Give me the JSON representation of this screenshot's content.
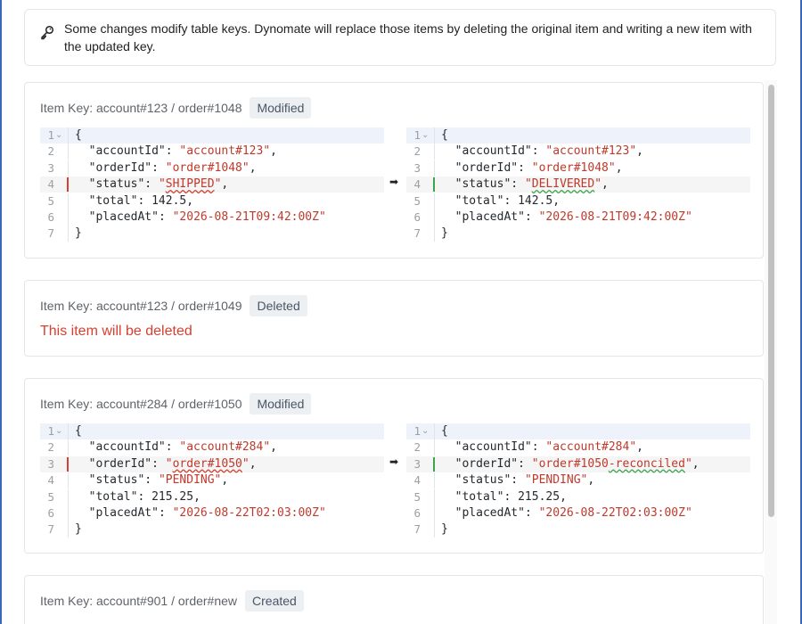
{
  "notice": {
    "icon": "key-icon",
    "text": "Some changes modify table keys. Dynomate will replace those items by deleting the original item and writing a new item with the updated key."
  },
  "colors": {
    "deleted": "#d64030",
    "added": "#3fa34d",
    "string": "#c0392b"
  },
  "items": [
    {
      "key_label": "Item Key: account#123 / order#1048",
      "status": "Modified",
      "changed_line": 4,
      "left": [
        {
          "n": "1",
          "text": "{"
        },
        {
          "n": "2",
          "key": "\"accountId\"",
          "val": "\"account#123\"",
          "tail": ","
        },
        {
          "n": "3",
          "key": "\"orderId\"",
          "val": "\"order#1048\"",
          "tail": ","
        },
        {
          "n": "4",
          "key": "\"status\"",
          "val": "\"SHIPPED\"",
          "tail": ","
        },
        {
          "n": "5",
          "key": "\"total\"",
          "num": "142.5",
          "tail": ","
        },
        {
          "n": "6",
          "key": "\"placedAt\"",
          "val": "\"2026-08-21T09:42:00Z\"",
          "tail": ""
        },
        {
          "n": "7",
          "text": "}"
        }
      ],
      "right": [
        {
          "n": "1",
          "text": "{"
        },
        {
          "n": "2",
          "key": "\"accountId\"",
          "val": "\"account#123\"",
          "tail": ","
        },
        {
          "n": "3",
          "key": "\"orderId\"",
          "val": "\"order#1048\"",
          "tail": ","
        },
        {
          "n": "4",
          "key": "\"status\"",
          "val": "\"DELIVERED\"",
          "tail": ","
        },
        {
          "n": "5",
          "key": "\"total\"",
          "num": "142.5",
          "tail": ","
        },
        {
          "n": "6",
          "key": "\"placedAt\"",
          "val": "\"2026-08-21T09:42:00Z\"",
          "tail": ""
        },
        {
          "n": "7",
          "text": "}"
        }
      ]
    },
    {
      "key_label": "Item Key: account#123 / order#1049",
      "status": "Deleted",
      "message": "This item will be deleted"
    },
    {
      "key_label": "Item Key: account#284 / order#1050",
      "status": "Modified",
      "changed_line": 3,
      "left": [
        {
          "n": "1",
          "text": "{"
        },
        {
          "n": "2",
          "key": "\"accountId\"",
          "val": "\"account#284\"",
          "tail": ","
        },
        {
          "n": "3",
          "key": "\"orderId\"",
          "val": "\"order#1050\"",
          "tail": ","
        },
        {
          "n": "4",
          "key": "\"status\"",
          "val": "\"PENDING\"",
          "tail": ","
        },
        {
          "n": "5",
          "key": "\"total\"",
          "num": "215.25",
          "tail": ","
        },
        {
          "n": "6",
          "key": "\"placedAt\"",
          "val": "\"2026-08-22T02:03:00Z\"",
          "tail": ""
        },
        {
          "n": "7",
          "text": "}"
        }
      ],
      "right": [
        {
          "n": "1",
          "text": "{"
        },
        {
          "n": "2",
          "key": "\"accountId\"",
          "val": "\"account#284\"",
          "tail": ","
        },
        {
          "n": "3",
          "key": "\"orderId\"",
          "val": "\"order#1050",
          "hl": "-reconciled",
          "after": "\"",
          "tail": ","
        },
        {
          "n": "4",
          "key": "\"status\"",
          "val": "\"PENDING\"",
          "tail": ","
        },
        {
          "n": "5",
          "key": "\"total\"",
          "num": "215.25",
          "tail": ","
        },
        {
          "n": "6",
          "key": "\"placedAt\"",
          "val": "\"2026-08-22T02:03:00Z\"",
          "tail": ""
        },
        {
          "n": "7",
          "text": "}"
        }
      ]
    },
    {
      "key_label": "Item Key: account#901 / order#new",
      "status": "Created"
    }
  ],
  "diff_arrow": "➡"
}
